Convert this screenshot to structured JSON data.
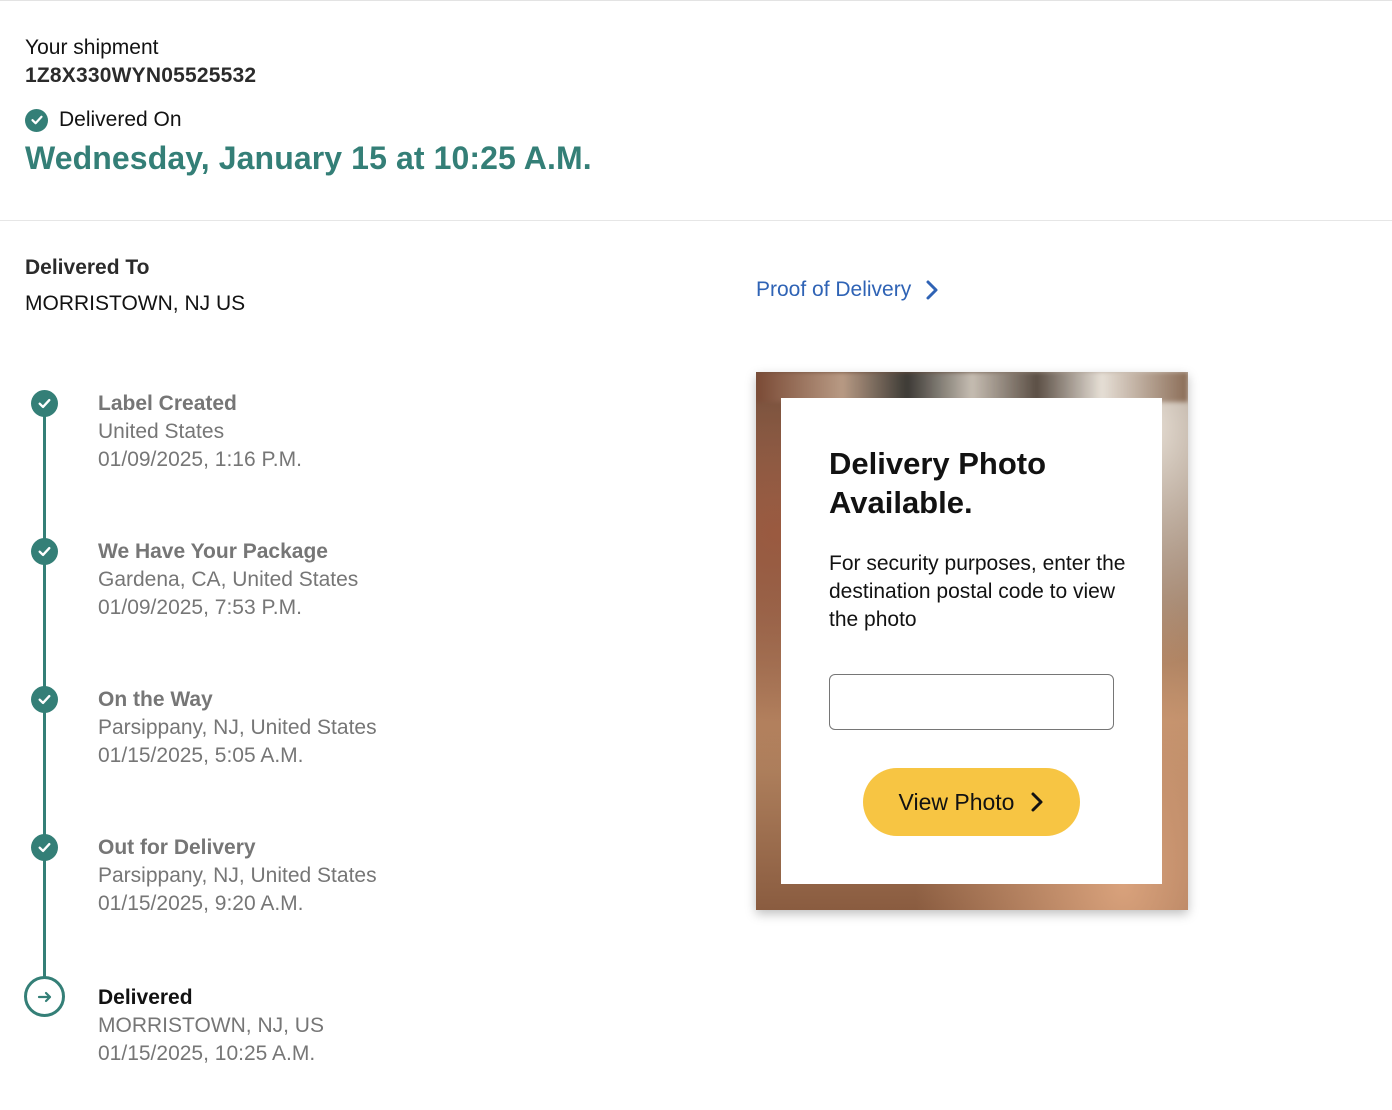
{
  "header": {
    "shipment_label": "Your shipment",
    "tracking_number": "1Z8X330WYN05525532",
    "delivered_on_label": "Delivered On",
    "delivered_date": "Wednesday, January 15 at 10:25 A.M."
  },
  "delivered_to": {
    "title": "Delivered To",
    "address": "MORRISTOWN, NJ US"
  },
  "proof_of_delivery": {
    "label": "Proof of Delivery"
  },
  "timeline": [
    {
      "title": "Label Created",
      "location": "United States",
      "time": "01/09/2025, 1:16 P.M.",
      "status": "done"
    },
    {
      "title": "We Have Your Package",
      "location": "Gardena, CA, United States",
      "time": "01/09/2025, 7:53 P.M.",
      "status": "done"
    },
    {
      "title": "On the Way",
      "location": "Parsippany, NJ, United States",
      "time": "01/15/2025, 5:05 A.M.",
      "status": "done"
    },
    {
      "title": "Out for Delivery",
      "location": "Parsippany, NJ, United States",
      "time": "01/15/2025, 9:20 A.M.",
      "status": "done"
    },
    {
      "title": "Delivered",
      "location": "MORRISTOWN, NJ, US",
      "time": "01/15/2025, 10:25 A.M.",
      "status": "current"
    }
  ],
  "photo_card": {
    "title": "Delivery Photo Available.",
    "description": "For security purposes, enter the destination postal code to view the photo",
    "postal_input_value": "",
    "button_label": "View Photo"
  },
  "colors": {
    "accent_teal": "#347f77",
    "link_blue": "#2f63b5",
    "button_yellow": "#f7c543",
    "muted_text": "#767676"
  },
  "icons": {
    "status": "check-circle-icon",
    "current": "arrow-right-circle-icon",
    "link": "chevron-right-icon"
  }
}
